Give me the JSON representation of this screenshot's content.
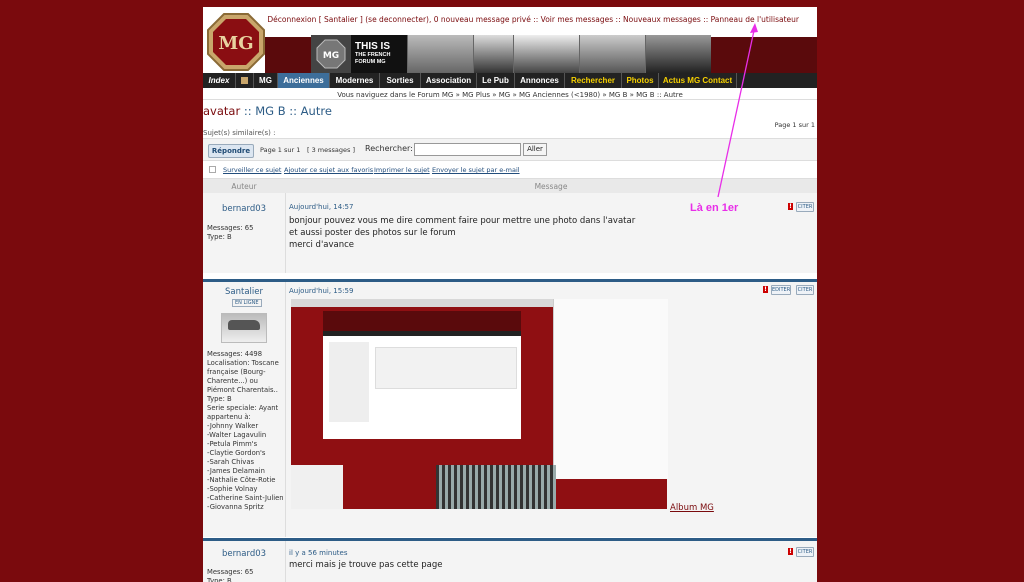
{
  "header": {
    "toplinks": "Déconnexion [ Santalier ] (se deconnecter), 0 nouveau message privé :: Voir mes messages :: Nouveaux messages :: Panneau de l'utilisateur",
    "banner_line1": "THIS IS",
    "banner_line2": "THE FRENCH",
    "banner_line3": "FORUM MG",
    "logo_text": "MG"
  },
  "nav": {
    "items": [
      "Index",
      "MG",
      "Anciennes",
      "Modernes",
      "Sorties",
      "Association",
      "Le Pub",
      "Annonces",
      "Rechercher",
      "Photos",
      "Actus MG Contact"
    ]
  },
  "breadcrumb": "Vous naviguez dans le Forum MG » MG Plus » MG » MG Anciennes (<1980) » MG B » MG B :: Autre",
  "topic": {
    "title_red": "avatar",
    "title_rest": " :: MG B :: Autre",
    "page_info": "Page 1 sur 1",
    "similaire": "Sujet(s) similaire(s) :"
  },
  "toolbar": {
    "reply": "Répondre",
    "page": "Page 1 sur 1",
    "messages": "[ 3 messages ]",
    "search_label": "Rechercher:",
    "search_value": "",
    "go": "Aller"
  },
  "subtools": {
    "watch": "Surveiller ce sujet",
    "favorite": "Ajouter ce sujet aux favoris",
    "print": "Imprimer le sujet",
    "email": "Envoyer le sujet par e-mail"
  },
  "table": {
    "col_author": "Auteur",
    "col_message": "Message"
  },
  "posts": [
    {
      "author": "bernard03",
      "messages": "Messages: 65",
      "type": "Type: B",
      "time": "Aujourd'hui, 14:57",
      "body": [
        "bonjour pouvez vous me dire comment faire pour mettre une photo dans l'avatar",
        "et aussi poster des photos sur le forum",
        "merci d'avance"
      ],
      "cite": "CITER"
    },
    {
      "author": "Santalier",
      "status": "EN LIGNE",
      "messages": "Messages: 4498",
      "location": "Localisation: Toscane française (Bourg-Charente...) ou Piémont Charentais..",
      "type": "Type: B",
      "serie": "Serie speciale: Ayant appartenu à:",
      "owners": [
        "-Johnny Walker",
        "-Walter Lagavulin",
        "-Petula Pimm's",
        "-Claytie Gordon's",
        "-Sarah Chivas",
        "-James Delamain",
        "-Nathalie Côte-Rotie",
        "-Sophie Volnay",
        "-Catherine Saint-Julien",
        "-Giovanna Spritz"
      ],
      "time": "Aujourd'hui, 15:59",
      "album": "Album MG",
      "edit": "EDITER",
      "cite": "CITER"
    },
    {
      "author": "bernard03",
      "messages": "Messages: 65",
      "type": "Type: B",
      "time": "il y a 56 minutes",
      "body": [
        "merci mais je trouve pas cette page"
      ],
      "cite": "CITER"
    }
  ],
  "annotation": {
    "text": "Là en 1er",
    "color": "#e82ee8"
  }
}
